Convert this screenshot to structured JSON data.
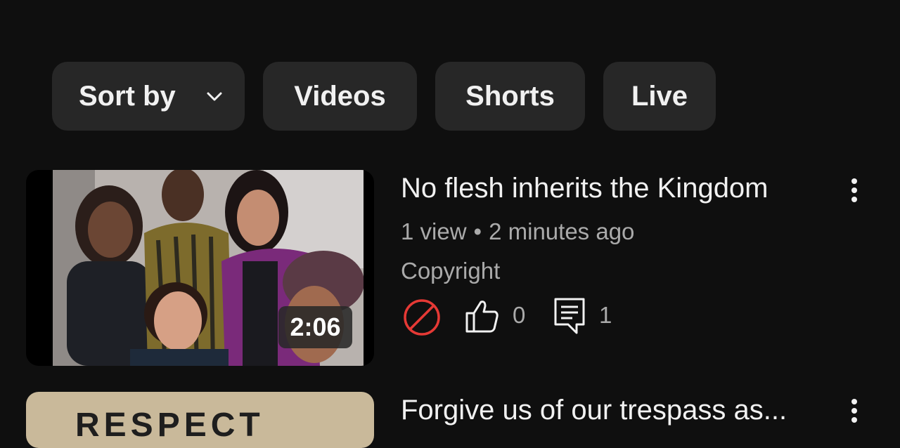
{
  "filters": {
    "sort_label": "Sort by",
    "chips": [
      "Videos",
      "Shorts",
      "Live"
    ]
  },
  "videos": [
    {
      "title": "No flesh inherits the Kingdom",
      "views": "1 view",
      "separator": "•",
      "age": "2 minutes ago",
      "status": "Copyright",
      "duration": "2:06",
      "likes": "0",
      "comments": "1"
    },
    {
      "title": "Forgive us of our trespass as...",
      "thumbnail_text": "RESPECT"
    }
  ],
  "colors": {
    "background": "#0f0f0f",
    "chip": "#272727",
    "restricted": "#e53935",
    "secondary_text": "#aaaaaa"
  }
}
